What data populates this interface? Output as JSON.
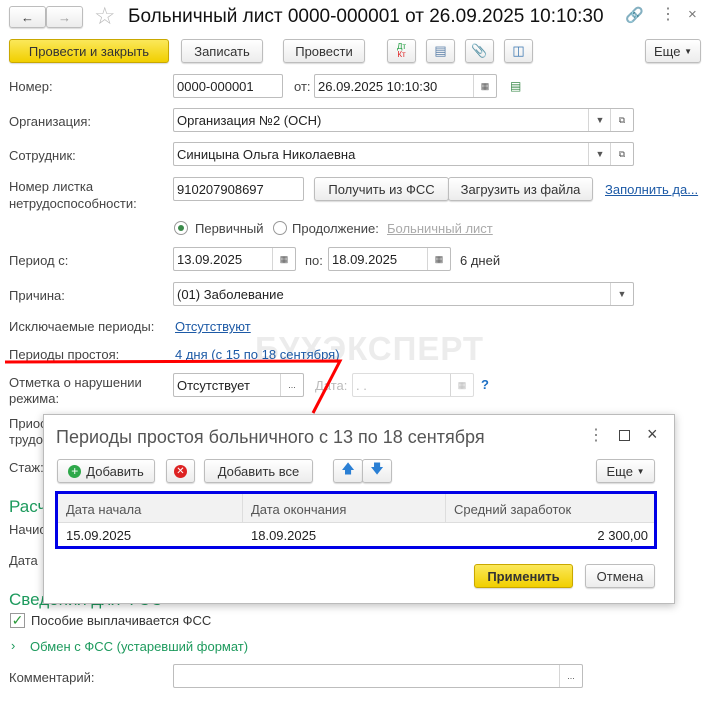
{
  "window": {
    "title": "Больничный лист 0000-000001 от 26.09.2025 10:10:30"
  },
  "toolbar": {
    "post_close": "Провести и закрыть",
    "save": "Записать",
    "post": "Провести",
    "dt": "Дт",
    "kt": "Кт",
    "more": "Еще"
  },
  "form": {
    "number_label": "Номер:",
    "number": "0000-000001",
    "from_label": "от:",
    "date": "26.09.2025 10:10:30",
    "org_label": "Организация:",
    "org": "Организация №2 (ОСН)",
    "emp_label": "Сотрудник:",
    "emp": "Синицына Ольга Николаевна",
    "sheet_label": "Номер листка нетрудоспособности:",
    "sheet": "910207908697",
    "get_fss": "Получить из ФСС",
    "load_file": "Загрузить из файла",
    "fill": "Заполнить да...",
    "primary": "Первичный",
    "continuation": "Продолжение:",
    "continuation_link": "Больничный лист",
    "period_label": "Период с:",
    "period_from": "13.09.2025",
    "period_to_label": "по:",
    "period_to": "18.09.2025",
    "days": "6 дней",
    "reason_label": "Причина:",
    "reason": "(01) Заболевание",
    "excluded_label": "Исключаемые периоды:",
    "excluded": "Отсутствуют",
    "idle_label": "Периоды простоя:",
    "idle": "4 дня (с 15 по 18 сентября)",
    "violation_label": "Отметка о нарушении режима:",
    "violation": "Отсутствует",
    "date_label": "Дата:",
    "date_empty": " .  .",
    "help": "?",
    "hidden1": "Приос",
    "hidden2": "трудо",
    "stazh": "Стаж:",
    "calc": "Расч",
    "nach": "Начис",
    "data": "Дата",
    "fss_section": "Сведения для ФСС",
    "fss_paid": "Пособие выплачивается ФСС",
    "exchange": "Обмен с ФСС (устаревший формат)",
    "comment_label": "Комментарий:",
    "watermark": "БУХЭКСПЕРТ"
  },
  "dialog": {
    "title": "Периоды простоя больничного с 13 по 18 сентября",
    "add": "Добавить",
    "add_all": "Добавить все",
    "more": "Еще",
    "columns": [
      "Дата начала",
      "Дата окончания",
      "Средний заработок"
    ],
    "rows": [
      [
        "15.09.2025",
        "18.09.2025",
        "2 300,00"
      ]
    ],
    "apply": "Применить",
    "cancel": "Отмена"
  }
}
